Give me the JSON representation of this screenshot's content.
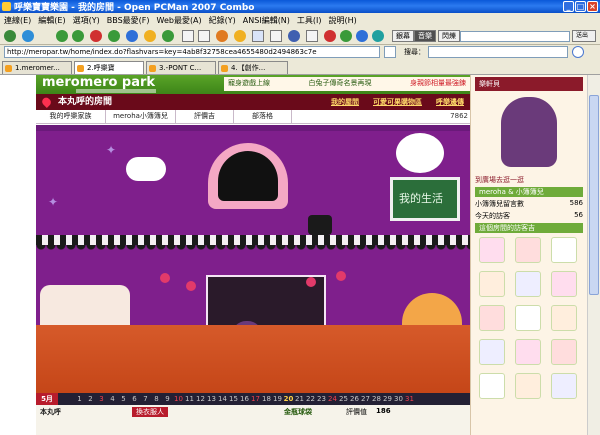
{
  "window": {
    "title": "呼樂寶寶樂園 - 我的房間 - Open PCMan 2007 Combo"
  },
  "menu": [
    "連線(E)",
    "編輯(E)",
    "選項(Y)",
    "BBS最愛(F)",
    "Web最愛(A)",
    "紀錄(Y)",
    "ANSI編輯(N)",
    "工具(I)",
    "說明(H)"
  ],
  "toolbar": {
    "mode_label": "銀幕",
    "music_label": "音樂",
    "flash_label": "閃爍",
    "send_label": "送出",
    "search_label": "搜尋："
  },
  "address": {
    "url": "http://meropar.tw/home/index.do?flashvars=key=4ab8f32758cea4655480d2494863c7e"
  },
  "tabs": [
    {
      "label": "1.meromer...",
      "active": false
    },
    {
      "label": "2.呼樂寶",
      "active": true
    },
    {
      "label": "3.-PONT C...",
      "active": false
    },
    {
      "label": "4.【創作...",
      "active": false
    }
  ],
  "site": {
    "logo": "meromero park",
    "header_links": [
      "寵身遊戲上線",
      "白兔子傳奇名景再現",
      "身親節相量最強鍊"
    ],
    "room_title": "本丸呼的房間",
    "room_links": [
      "我的屋間",
      "可愛可果購物區",
      "呼樂邊傳"
    ],
    "room_nav": [
      "我的呼樂家族",
      "meroha小簿簿兒",
      "評價吉",
      "部落格"
    ],
    "visit_count": "7862",
    "chalkboard_text": "我的生活",
    "status_name": "本丸呼",
    "status_button": "換衣服人",
    "status_room": "金瓶球袋",
    "status_label": "評價值",
    "status_value": "186"
  },
  "calendar": {
    "month": "5月",
    "days": [
      "1",
      "2",
      "3",
      "4",
      "5",
      "6",
      "7",
      "8",
      "9",
      "10",
      "11",
      "12",
      "13",
      "14",
      "15",
      "16",
      "17",
      "18",
      "19",
      "20",
      "21",
      "22",
      "23",
      "24",
      "25",
      "26",
      "27",
      "28",
      "29",
      "30",
      "31"
    ],
    "sunday_indexes": [
      2,
      9,
      16,
      23,
      30
    ],
    "today_index": 19
  },
  "sidebar": {
    "owner_name": "樂軒貝",
    "gift_label": "到廣場去逛一逛",
    "section1": "meroha & 小簿簿兒",
    "stats": [
      {
        "label": "小簿簿兒留言數",
        "value": "586"
      },
      {
        "label": "今天的訪客",
        "value": "56"
      }
    ],
    "section2": "這個房間的訪客吉"
  }
}
